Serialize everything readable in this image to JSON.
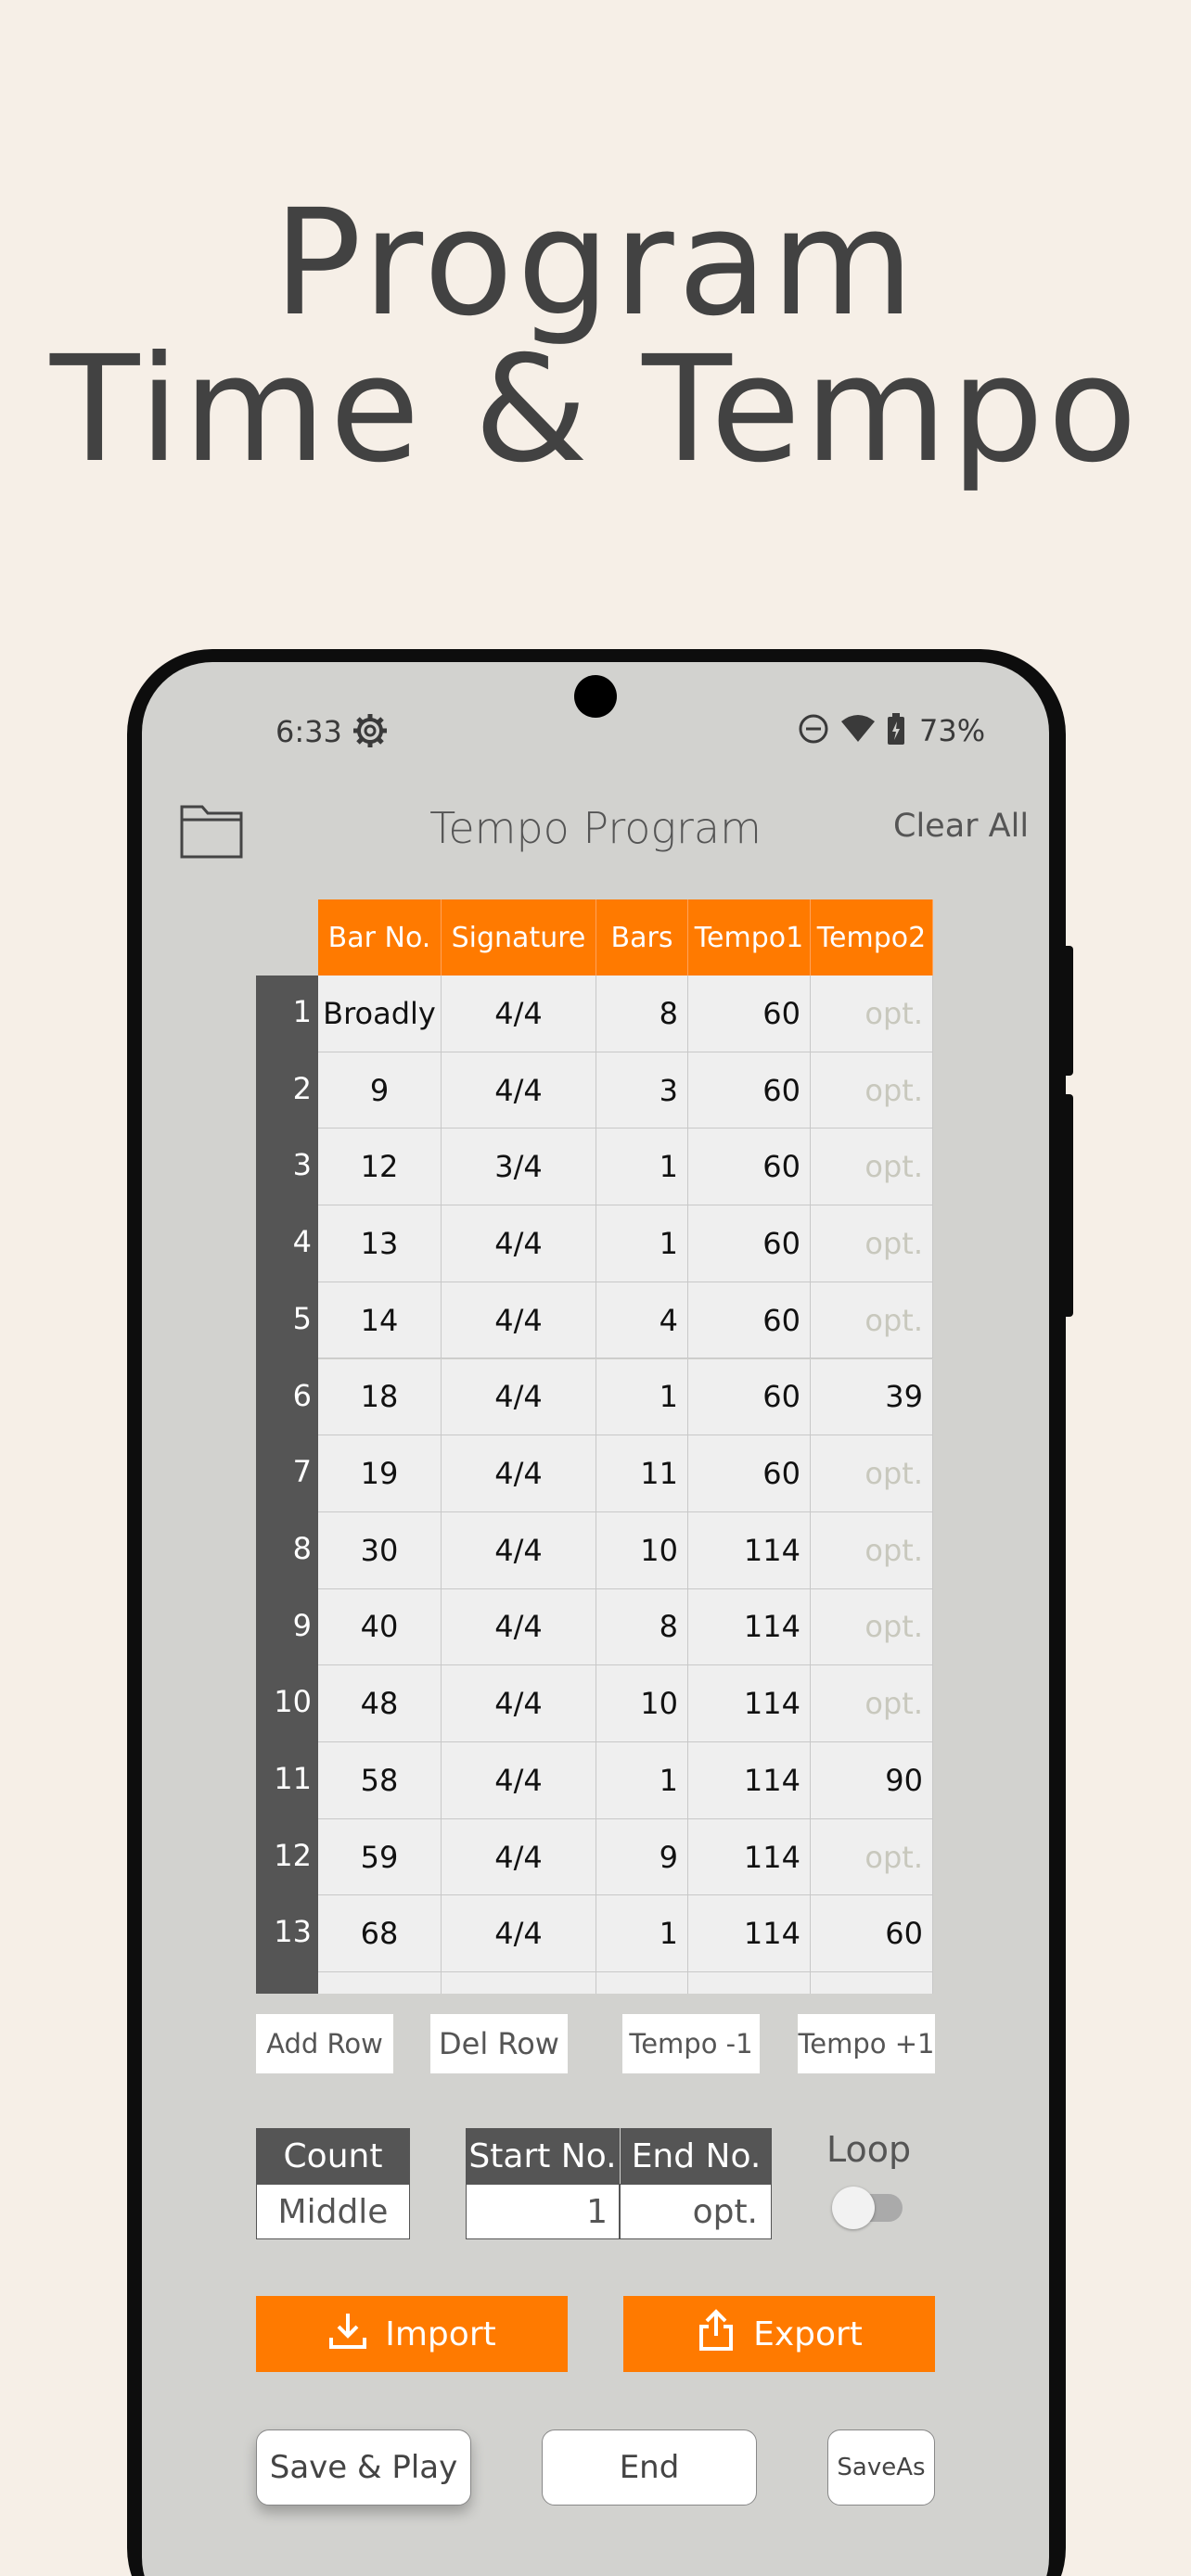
{
  "hero": {
    "line1": "Program",
    "line2": "Time & Tempo"
  },
  "status_bar": {
    "time": "6:33",
    "battery": "73%",
    "icons": [
      "gear-icon",
      "do-not-disturb-icon",
      "wifi-icon",
      "battery-icon"
    ]
  },
  "app": {
    "title": "Tempo Program",
    "clear_all": "Clear All",
    "folder_icon": "folder-icon"
  },
  "table": {
    "headers": [
      "Bar No.",
      "Signature",
      "Bars",
      "Tempo1",
      "Tempo2"
    ],
    "rows": [
      {
        "n": "1",
        "bar": "Broadly",
        "sig": "4/4",
        "bars": "8",
        "t1": "60",
        "t2": "opt."
      },
      {
        "n": "2",
        "bar": "9",
        "sig": "4/4",
        "bars": "3",
        "t1": "60",
        "t2": "opt."
      },
      {
        "n": "3",
        "bar": "12",
        "sig": "3/4",
        "bars": "1",
        "t1": "60",
        "t2": "opt."
      },
      {
        "n": "4",
        "bar": "13",
        "sig": "4/4",
        "bars": "1",
        "t1": "60",
        "t2": "opt."
      },
      {
        "n": "5",
        "bar": "14",
        "sig": "4/4",
        "bars": "4",
        "t1": "60",
        "t2": "opt."
      },
      {
        "n": "6",
        "bar": "18",
        "sig": "4/4",
        "bars": "1",
        "t1": "60",
        "t2": "39"
      },
      {
        "n": "7",
        "bar": "19",
        "sig": "4/4",
        "bars": "11",
        "t1": "60",
        "t2": "opt."
      },
      {
        "n": "8",
        "bar": "30",
        "sig": "4/4",
        "bars": "10",
        "t1": "114",
        "t2": "opt."
      },
      {
        "n": "9",
        "bar": "40",
        "sig": "4/4",
        "bars": "8",
        "t1": "114",
        "t2": "opt."
      },
      {
        "n": "10",
        "bar": "48",
        "sig": "4/4",
        "bars": "10",
        "t1": "114",
        "t2": "opt."
      },
      {
        "n": "11",
        "bar": "58",
        "sig": "4/4",
        "bars": "1",
        "t1": "114",
        "t2": "90"
      },
      {
        "n": "12",
        "bar": "59",
        "sig": "4/4",
        "bars": "9",
        "t1": "114",
        "t2": "opt."
      },
      {
        "n": "13",
        "bar": "68",
        "sig": "4/4",
        "bars": "1",
        "t1": "114",
        "t2": "60"
      }
    ]
  },
  "row_buttons": {
    "add_row": "Add Row",
    "del_row": "Del Row",
    "tempo_minus": "Tempo -1",
    "tempo_plus": "Tempo +1"
  },
  "count": {
    "header": "Count",
    "value": "Middle"
  },
  "range": {
    "start_header": "Start No.",
    "start_value": "1",
    "end_header": "End No.",
    "end_value": "opt."
  },
  "loop": {
    "label": "Loop",
    "on": false
  },
  "io_buttons": {
    "import": "Import",
    "export": "Export"
  },
  "bottom_buttons": {
    "save_play": "Save & Play",
    "end": "End",
    "save_as": "SaveAs"
  },
  "colors": {
    "accent": "#ff7a00",
    "row_number_bg": "#555555",
    "screen_bg": "#d2d2cf",
    "page_bg": "#f6efe7"
  }
}
